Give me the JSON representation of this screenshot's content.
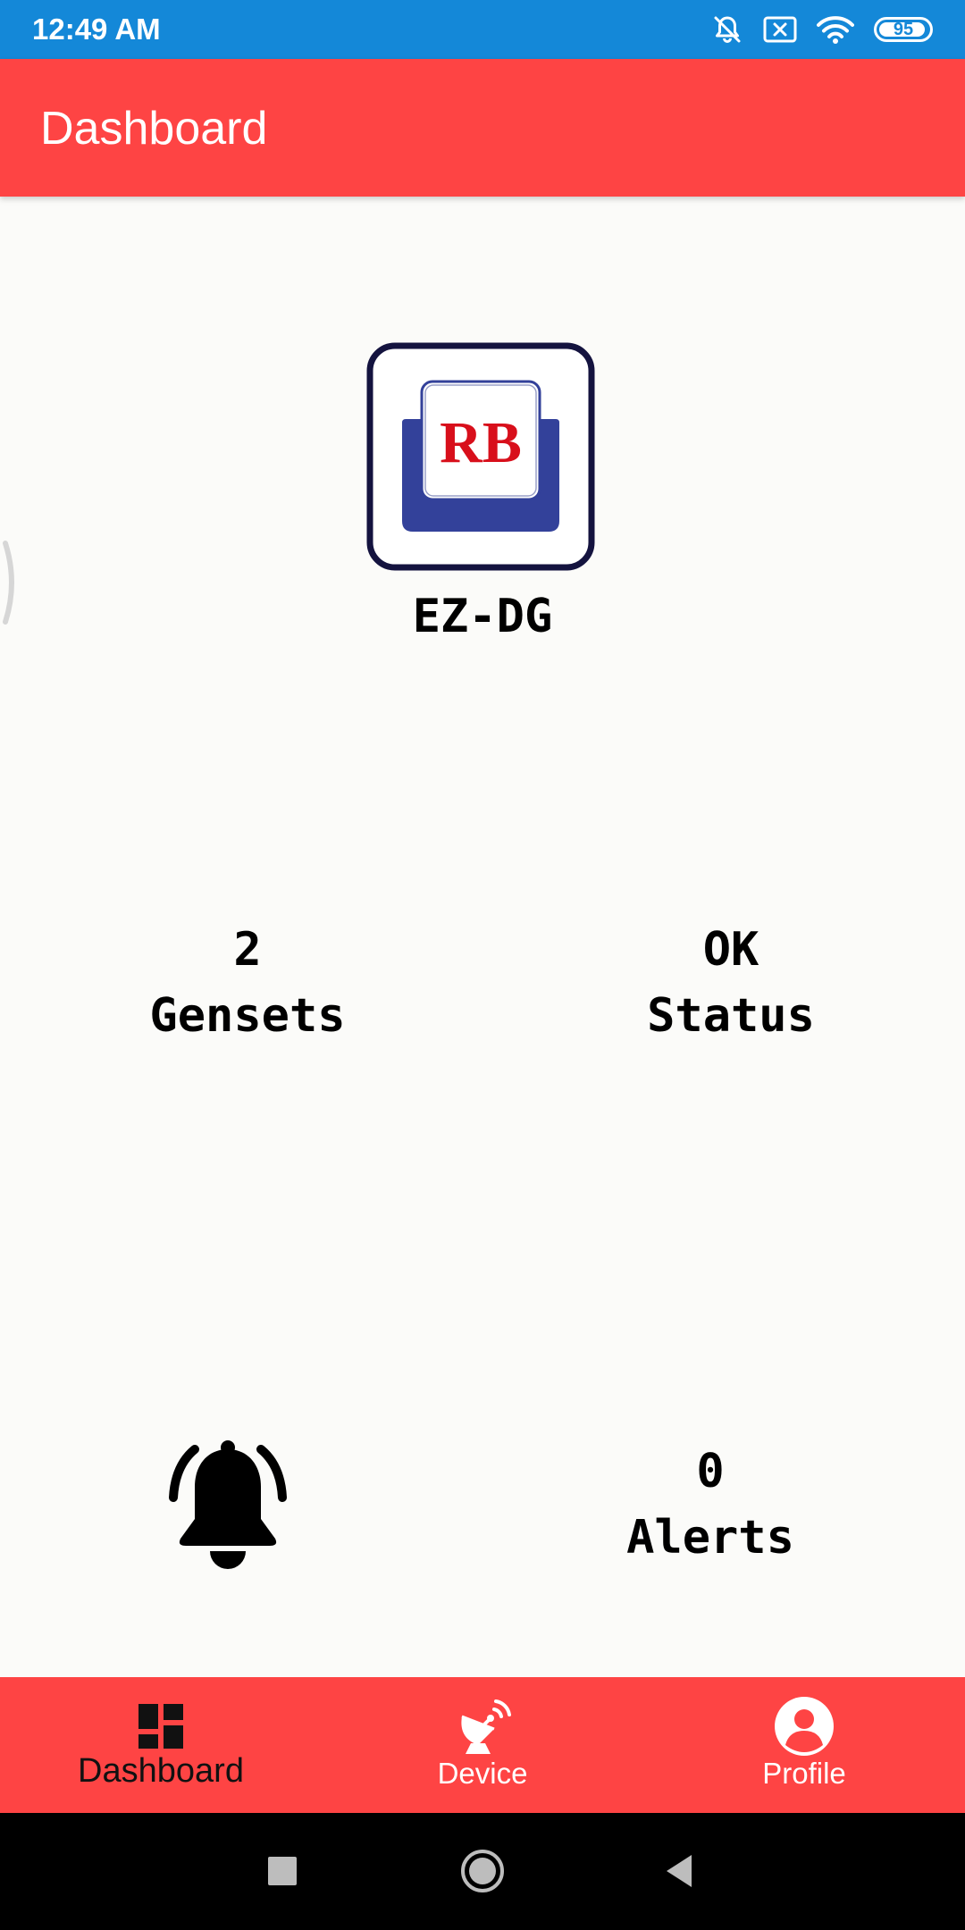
{
  "status_bar": {
    "time": "12:49 AM",
    "battery": "95",
    "battery_level": 0.95,
    "icons": [
      "mute-icon",
      "sim-off-icon",
      "wifi-icon",
      "battery-icon"
    ],
    "background": "#1488d8"
  },
  "app_bar": {
    "title": "Dashboard",
    "background": "#fe4444"
  },
  "logo": {
    "text": "RB",
    "text_color": "#d80f1b",
    "tile_color": "#33419a",
    "frame_color": "#14133f"
  },
  "brand": {
    "name": "EZ-DG"
  },
  "stats": {
    "gensets": {
      "value": "2",
      "label": "Gensets"
    },
    "status": {
      "value": "OK",
      "label": "Status"
    },
    "alerts": {
      "value": "0",
      "label": "Alerts",
      "icon": "bell-icon"
    }
  },
  "bottom_nav": {
    "background": "#fe4444",
    "items": [
      {
        "label": "Dashboard",
        "icon": "dashboard-icon",
        "active": true
      },
      {
        "label": "Device",
        "icon": "satellite-dish-icon",
        "active": false
      },
      {
        "label": "Profile",
        "icon": "profile-icon",
        "active": false
      }
    ]
  },
  "system_nav": {
    "buttons": [
      "recents-icon",
      "home-icon",
      "back-icon"
    ]
  }
}
